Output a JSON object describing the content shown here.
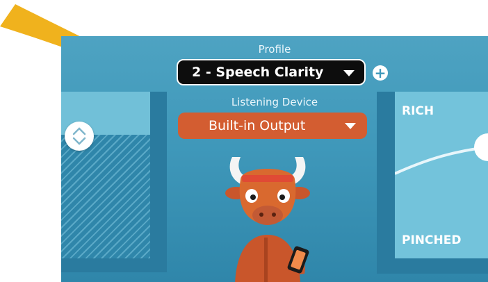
{
  "profile": {
    "label": "Profile",
    "selected": "2 - Speech Clarity",
    "add_symbol": "+"
  },
  "listening_device": {
    "label": "Listening Device",
    "selected": "Built-in Output"
  },
  "eq_panel": {
    "top_label": "RICH",
    "bottom_label": "PINCHED"
  },
  "colors": {
    "accent_orange": "#d35d31",
    "arrow_yellow": "#f0b21d",
    "background_blue": "#3f98ba"
  },
  "icons": [
    "arrow-pointer-icon",
    "plus-icon",
    "chevron-updown-icon",
    "dropdown-caret-icon",
    "bull-mascot"
  ]
}
